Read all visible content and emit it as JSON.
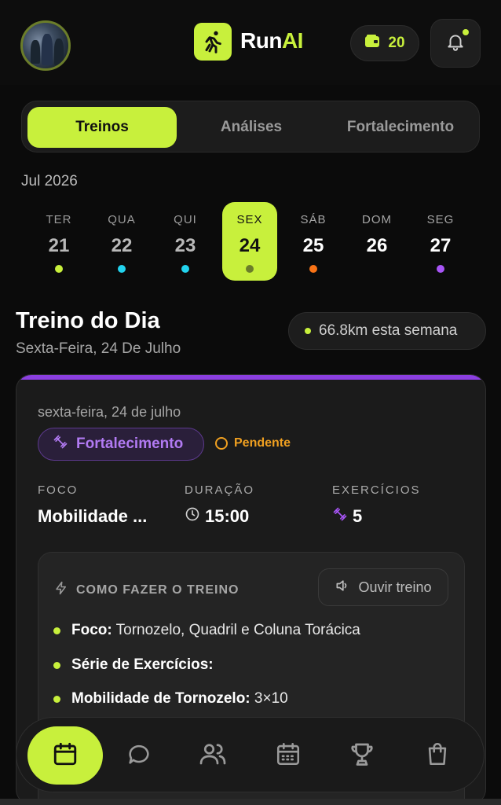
{
  "header": {
    "logo_prefix": "Run",
    "logo_suffix": "AI",
    "wallet_count": "20",
    "brand_color": "#c8f03c"
  },
  "tabs": [
    {
      "label": "Treinos",
      "active": true
    },
    {
      "label": "Análises",
      "active": false
    },
    {
      "label": "Fortalecimento",
      "active": false
    }
  ],
  "calendar": {
    "month": "Jul 2026",
    "days": [
      {
        "name": "TER",
        "num": "21",
        "dot": "#c8f03c"
      },
      {
        "name": "QUA",
        "num": "22",
        "dot": "#22d3ee"
      },
      {
        "name": "QUI",
        "num": "23",
        "dot": "#22d3ee"
      },
      {
        "name": "SEX",
        "num": "24",
        "dot": "#6b7d2a",
        "active": true
      },
      {
        "name": "SÁB",
        "num": "25",
        "dot": "#f97316"
      },
      {
        "name": "DOM",
        "num": "26",
        "dot": ""
      },
      {
        "name": "SEG",
        "num": "27",
        "dot": "#a855f7"
      }
    ]
  },
  "workout_section": {
    "title": "Treino do Dia",
    "subtitle": "Sexta-Feira, 24 De Julho",
    "week_distance": "66.8km esta semana"
  },
  "card": {
    "date": "sexta-feira, 24 de julho",
    "category": "Fortalecimento",
    "status": "Pendente",
    "stats": [
      {
        "label": "FOCO",
        "value": "Mobilidade ..."
      },
      {
        "label": "DURAÇÃO",
        "value": "15:00"
      },
      {
        "label": "EXERCÍCIOS",
        "value": "5"
      }
    ],
    "howto": {
      "title": "COMO FAZER O TREINO",
      "listen_label": "Ouvir treino",
      "items": [
        {
          "bold": "Foco:",
          "text": " Tornozelo, Quadril e Coluna Torácica"
        },
        {
          "bold": "Série de Exercícios:",
          "text": ""
        },
        {
          "bold": "Mobilidade de Tornozelo:",
          "text": " 3×10"
        }
      ]
    }
  },
  "bottom_nav": [
    {
      "icon": "calendar-icon",
      "active": true
    },
    {
      "icon": "chat-icon"
    },
    {
      "icon": "users-icon"
    },
    {
      "icon": "schedule-icon"
    },
    {
      "icon": "trophy-icon"
    },
    {
      "icon": "shopping-bag-icon"
    }
  ]
}
